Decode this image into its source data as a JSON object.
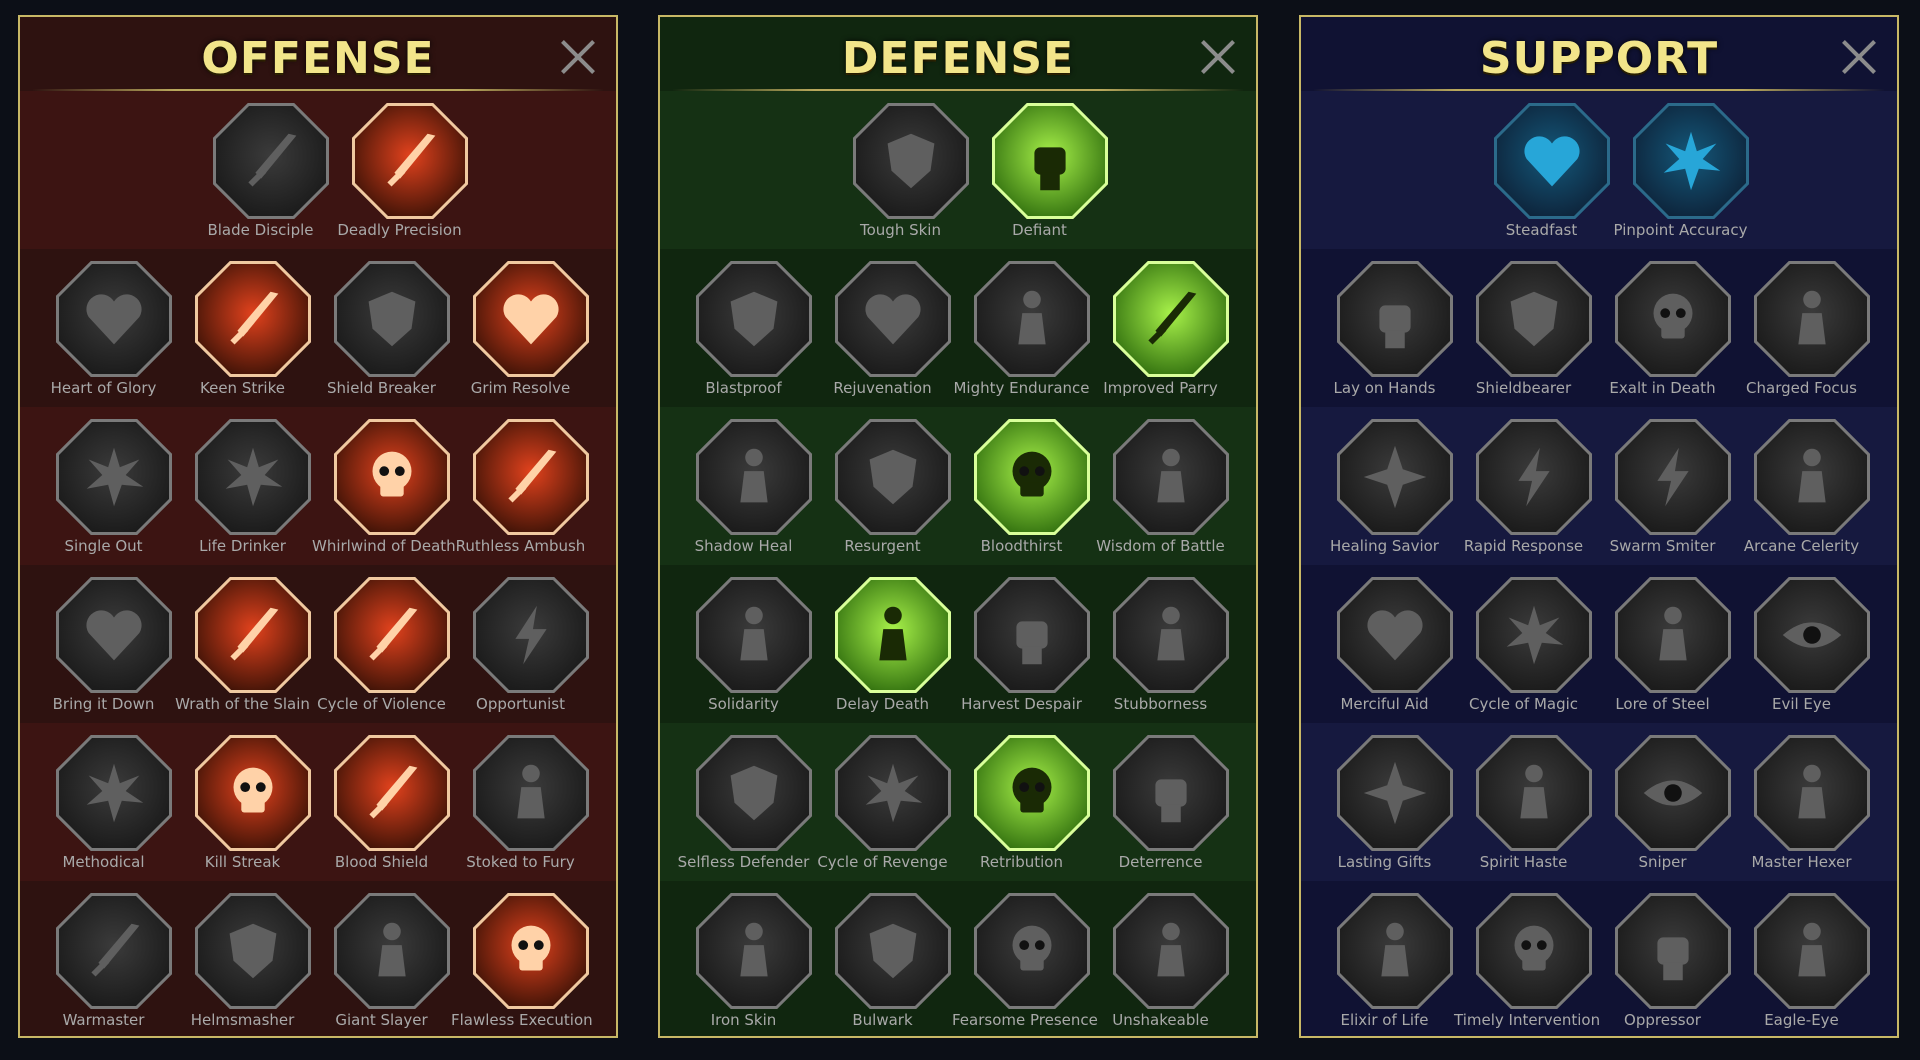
{
  "colors": {
    "title": "#f2e58a",
    "offense_bg": "#2e1210",
    "offense_bg_alt": "#3c1412",
    "offense_active": "#e2421d",
    "defense_bg": "#10260f",
    "defense_bg_alt": "#153114",
    "defense_active": "#6fd31f",
    "support_bg": "#101233",
    "support_bg_alt": "#16193f",
    "support_active": "#1e7fa6"
  },
  "panels": [
    {
      "key": "offense",
      "title": "OFFENSE",
      "close_icon": "close-icon",
      "tiers": [
        [
          {
            "label": "Blade Disciple",
            "icon": "crossed-swords-icon",
            "active": false
          },
          {
            "label": "Deadly Precision",
            "icon": "dagger-burst-icon",
            "active": true
          }
        ],
        [
          {
            "label": "Heart of Glory",
            "icon": "horned-heart-icon",
            "active": false
          },
          {
            "label": "Keen Strike",
            "icon": "slash-strike-icon",
            "active": true
          },
          {
            "label": "Shield Breaker",
            "icon": "broken-shield-icon",
            "active": false
          },
          {
            "label": "Grim Resolve",
            "icon": "dripping-heart-icon",
            "active": true
          }
        ],
        [
          {
            "label": "Single Out",
            "icon": "arrow-target-icon",
            "active": false
          },
          {
            "label": "Life Drinker",
            "icon": "fangs-icon",
            "active": false
          },
          {
            "label": "Whirlwind of Death",
            "icon": "skull-whirl-icon",
            "active": true
          },
          {
            "label": "Ruthless Ambush",
            "icon": "knife-hand-icon",
            "active": true
          }
        ],
        [
          {
            "label": "Bring it Down",
            "icon": "heart-sword-icon",
            "active": false
          },
          {
            "label": "Wrath of the Slain",
            "icon": "fist-blade-icon",
            "active": true
          },
          {
            "label": "Cycle of Violence",
            "icon": "axe-cycle-icon",
            "active": true
          },
          {
            "label": "Opportunist",
            "icon": "chain-bolt-icon",
            "active": false
          }
        ],
        [
          {
            "label": "Methodical",
            "icon": "claw-marks-icon",
            "active": false
          },
          {
            "label": "Kill Streak",
            "icon": "triple-skull-icon",
            "active": true
          },
          {
            "label": "Blood Shield",
            "icon": "sword-shield-icon",
            "active": true
          },
          {
            "label": "Stoked to Fury",
            "icon": "rage-figure-icon",
            "active": false
          }
        ],
        [
          {
            "label": "Warmaster",
            "icon": "sword-sparkle-icon",
            "active": false
          },
          {
            "label": "Helmsmasher",
            "icon": "helmet-icon",
            "active": false
          },
          {
            "label": "Giant Slayer",
            "icon": "giant-icon",
            "active": false
          },
          {
            "label": "Flawless Execution",
            "icon": "spartan-skull-icon",
            "active": true
          }
        ]
      ]
    },
    {
      "key": "defense",
      "title": "DEFENSE",
      "close_icon": "close-icon",
      "tiers": [
        [
          {
            "label": "Tough Skin",
            "icon": "armor-plates-icon",
            "active": false
          },
          {
            "label": "Defiant",
            "icon": "raised-fist-icon",
            "active": true
          }
        ],
        [
          {
            "label": "Blastproof",
            "icon": "shield-chevron-icon",
            "active": false
          },
          {
            "label": "Rejuvenation",
            "icon": "heart-organ-icon",
            "active": false
          },
          {
            "label": "Mighty Endurance",
            "icon": "armored-body-icon",
            "active": false
          },
          {
            "label": "Improved Parry",
            "icon": "crossed-blades-icon",
            "active": true
          }
        ],
        [
          {
            "label": "Shadow Heal",
            "icon": "shadow-figure-icon",
            "active": false
          },
          {
            "label": "Resurgent",
            "icon": "knight-icon",
            "active": false
          },
          {
            "label": "Bloodthirst",
            "icon": "skull-heart-icon",
            "active": true
          },
          {
            "label": "Wisdom of Battle",
            "icon": "hooded-face-icon",
            "active": false
          }
        ],
        [
          {
            "label": "Solidarity",
            "icon": "group-icon",
            "active": false
          },
          {
            "label": "Delay Death",
            "icon": "hourglass-icon",
            "active": true
          },
          {
            "label": "Harvest Despair",
            "icon": "open-hand-icon",
            "active": false
          },
          {
            "label": "Stubborness",
            "icon": "bull-icon",
            "active": false
          }
        ],
        [
          {
            "label": "Selfless Defender",
            "icon": "runner-shield-icon",
            "active": false
          },
          {
            "label": "Cycle of Revenge",
            "icon": "drops-icon",
            "active": false
          },
          {
            "label": "Retribution",
            "icon": "sun-skull-icon",
            "active": true
          },
          {
            "label": "Deterrence",
            "icon": "hand-deflect-icon",
            "active": false
          }
        ],
        [
          {
            "label": "Iron Skin",
            "icon": "spiked-head-icon",
            "active": false
          },
          {
            "label": "Bulwark",
            "icon": "winged-shield-icon",
            "active": false
          },
          {
            "label": "Fearsome Presence",
            "icon": "hooded-skull-icon",
            "active": false
          },
          {
            "label": "Unshakeable",
            "icon": "strongman-icon",
            "active": false
          }
        ]
      ]
    },
    {
      "key": "support",
      "title": "SUPPORT",
      "close_icon": "close-icon",
      "tiers": [
        [
          {
            "label": "Steadfast",
            "icon": "heart-plus-icon",
            "active": true
          },
          {
            "label": "Pinpoint Accuracy",
            "icon": "target-streak-icon",
            "active": true
          }
        ],
        [
          {
            "label": "Lay on Hands",
            "icon": "praying-hands-icon",
            "active": false
          },
          {
            "label": "Shieldbearer",
            "icon": "ring-shield-icon",
            "active": false
          },
          {
            "label": "Exalt in Death",
            "icon": "flame-skull-icon",
            "active": false
          },
          {
            "label": "Charged Focus",
            "icon": "speed-lines-icon",
            "active": false
          }
        ],
        [
          {
            "label": "Healing Savior",
            "icon": "sparkle-figure-icon",
            "active": false
          },
          {
            "label": "Rapid Response",
            "icon": "lightning-icon",
            "active": false
          },
          {
            "label": "Swarm Smiter",
            "icon": "zigzag-icon",
            "active": false
          },
          {
            "label": "Arcane Celerity",
            "icon": "fast-figure-icon",
            "active": false
          }
        ],
        [
          {
            "label": "Merciful Aid",
            "icon": "chained-heart-icon",
            "active": false
          },
          {
            "label": "Cycle of Magic",
            "icon": "comet-icon",
            "active": false
          },
          {
            "label": "Lore of Steel",
            "icon": "open-book-icon",
            "active": false
          },
          {
            "label": "Evil Eye",
            "icon": "burst-eye-icon",
            "active": false
          }
        ],
        [
          {
            "label": "Lasting Gifts",
            "icon": "compass-star-icon",
            "active": false
          },
          {
            "label": "Spirit Haste",
            "icon": "winged-boot-icon",
            "active": false
          },
          {
            "label": "Sniper",
            "icon": "eye-icon",
            "active": false
          },
          {
            "label": "Master Hexer",
            "icon": "voodoo-doll-icon",
            "active": false
          }
        ],
        [
          {
            "label": "Elixir of Life",
            "icon": "potion-icon",
            "active": false
          },
          {
            "label": "Timely Intervention",
            "icon": "winged-skull-icon",
            "active": false
          },
          {
            "label": "Oppressor",
            "icon": "gauntlet-icon",
            "active": false
          },
          {
            "label": "Eagle-Eye",
            "icon": "eagle-icon",
            "active": false
          }
        ]
      ]
    }
  ]
}
